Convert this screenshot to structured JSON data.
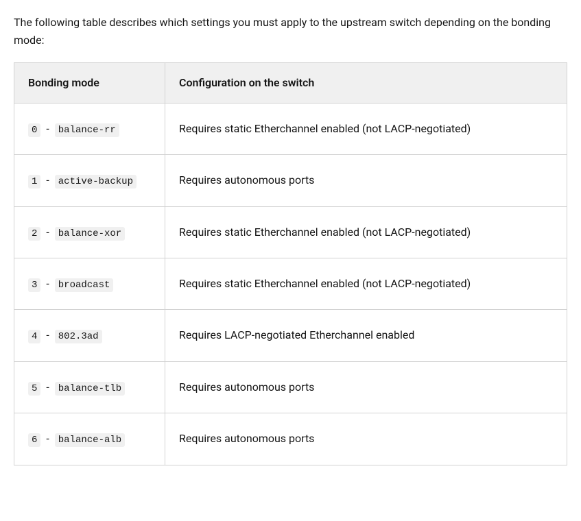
{
  "intro": "The following table describes which settings you must apply to the upstream switch depending on the bonding mode:",
  "table": {
    "headers": {
      "mode": "Bonding mode",
      "config": "Configuration on the switch"
    },
    "rows": [
      {
        "code": "0",
        "name": "balance-rr",
        "config": "Requires static Etherchannel enabled (not LACP-negotiated)"
      },
      {
        "code": "1",
        "name": "active-backup",
        "config": "Requires autonomous ports"
      },
      {
        "code": "2",
        "name": "balance-xor",
        "config": "Requires static Etherchannel enabled (not LACP-negotiated)"
      },
      {
        "code": "3",
        "name": "broadcast",
        "config": "Requires static Etherchannel enabled (not LACP-negotiated)"
      },
      {
        "code": "4",
        "name": "802.3ad",
        "config": "Requires LACP-negotiated Etherchannel enabled"
      },
      {
        "code": "5",
        "name": "balance-tlb",
        "config": "Requires autonomous ports"
      },
      {
        "code": "6",
        "name": "balance-alb",
        "config": "Requires autonomous ports"
      }
    ]
  }
}
